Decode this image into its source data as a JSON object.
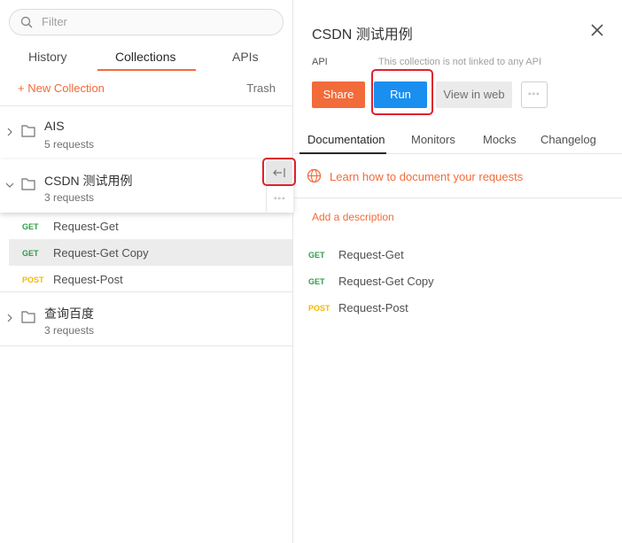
{
  "sidebar": {
    "search_placeholder": "Filter",
    "tabs": [
      "History",
      "Collections",
      "APIs"
    ],
    "new_collection": "+ New Collection",
    "trash": "Trash",
    "collections": [
      {
        "name": "AIS",
        "count": "5 requests"
      },
      {
        "name": "CSDN 测试用例",
        "count": "3 requests",
        "requests": [
          {
            "method": "GET",
            "name": "Request-Get"
          },
          {
            "method": "GET",
            "name": "Request-Get Copy"
          },
          {
            "method": "POST",
            "name": "Request-Post"
          }
        ]
      },
      {
        "name": "查询百度",
        "count": "3 requests"
      }
    ]
  },
  "panel": {
    "title": "CSDN 测试用例",
    "api_label": "API",
    "api_note": "This collection is not linked to any API",
    "buttons": {
      "share": "Share",
      "run": "Run",
      "view_web": "View in web",
      "more": "◦◦◦"
    },
    "tabs": [
      "Documentation",
      "Monitors",
      "Mocks",
      "Changelog"
    ],
    "learn": "Learn how to document your requests",
    "add_description": "Add a description",
    "requests": [
      {
        "method": "GET",
        "name": "Request-Get"
      },
      {
        "method": "GET",
        "name": "Request-Get Copy"
      },
      {
        "method": "POST",
        "name": "Request-Post"
      }
    ]
  },
  "colors": {
    "accent": "#f26b3a",
    "run": "#1a8ff0",
    "get": "#2f9e44",
    "post": "#f5b800",
    "highlight": "#e0202c"
  }
}
